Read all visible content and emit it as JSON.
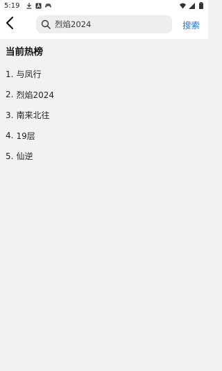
{
  "status_bar": {
    "time": "5:19",
    "left_icons": [
      "download-icon",
      "a-icon",
      "game-icon"
    ],
    "right_icons": [
      "wifi-icon",
      "signal-icon",
      "battery-icon"
    ]
  },
  "header": {
    "back_icon": "chevron-left-icon",
    "search": {
      "icon": "search-icon",
      "value": "烈焰2024",
      "placeholder": ""
    },
    "search_button_label": "搜索"
  },
  "hot_list": {
    "title": "当前热榜",
    "items": [
      {
        "rank": "1.",
        "label": "与凤行"
      },
      {
        "rank": "2.",
        "label": "烈焰2024"
      },
      {
        "rank": "3.",
        "label": "南来北往"
      },
      {
        "rank": "4.",
        "label": "19层"
      },
      {
        "rank": "5.",
        "label": "仙逆"
      }
    ]
  },
  "colors": {
    "accent": "#1677ff",
    "background": "#f2f2f2",
    "header_bg": "#ffffff",
    "search_bg": "#eeeeee"
  }
}
